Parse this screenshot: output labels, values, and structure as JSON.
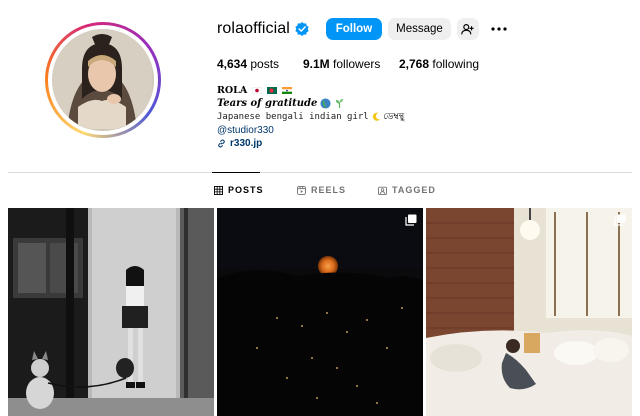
{
  "profile": {
    "username": "rolaofficial",
    "follow_label": "Follow",
    "message_label": "Message",
    "stats": {
      "posts_count": "4,634",
      "posts_label": "posts",
      "followers_count": "9.1M",
      "followers_label": "followers",
      "following_count": "2,768",
      "following_label": "following"
    },
    "bio": {
      "name": "ROLA",
      "line2": "Tears of gratitude",
      "line3": "Japanese bengali indian girl",
      "line3_suffix": "ডেম্বন্থু",
      "mention": "@studior330",
      "link": "r330.jp"
    }
  },
  "tabs": [
    {
      "label": "POSTS",
      "icon": "grid-icon",
      "active": true
    },
    {
      "label": "REELS",
      "icon": "reels-icon",
      "active": false
    },
    {
      "label": "TAGGED",
      "icon": "tagged-icon",
      "active": false
    }
  ],
  "colors": {
    "accent": "#0095f6",
    "link": "#00376b",
    "secondary_button": "#efefef"
  },
  "posts": [
    {
      "icon": null
    },
    {
      "icon": "multi-image-icon"
    },
    {
      "icon": "multi-image-icon"
    }
  ]
}
